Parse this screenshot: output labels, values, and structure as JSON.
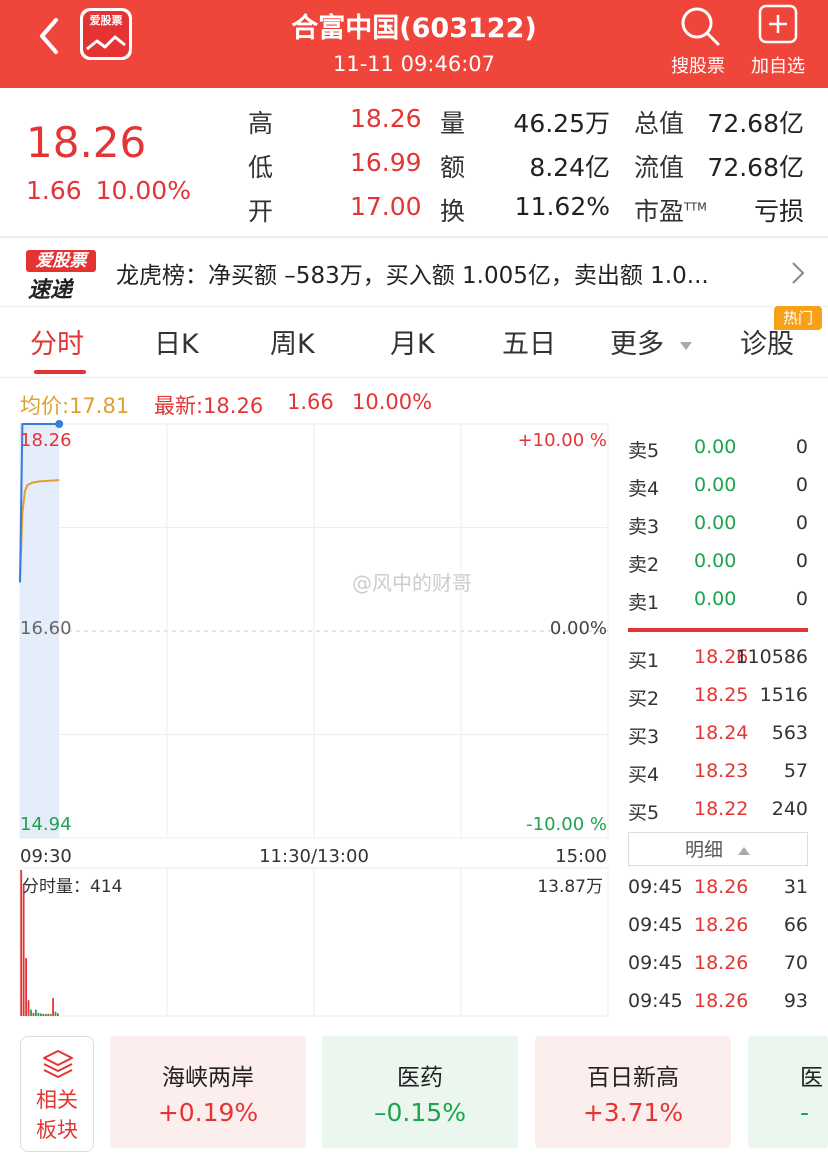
{
  "header": {
    "title": "合富中国(603122)",
    "datetime": "11-11 09:46:07",
    "logo_text": "爱股票",
    "search_label": "搜股票",
    "add_label": "加自选"
  },
  "quote": {
    "price": "18.26",
    "change": "1.66",
    "change_pct": "10.00%",
    "high_label": "高",
    "high": "18.26",
    "low_label": "低",
    "low": "16.99",
    "open_label": "开",
    "open": "17.00",
    "volume_label": "量",
    "volume": "46.25万",
    "amount_label": "额",
    "amount": "8.24亿",
    "turnover_label": "换",
    "turnover": "11.62%",
    "total_cap_label": "总值",
    "total_cap": "72.68亿",
    "float_cap_label": "流值",
    "float_cap": "72.68亿",
    "pe_label": "市盈",
    "pe_sup": "TTM",
    "pe": "亏损"
  },
  "news": {
    "logo_top": "爱股票",
    "logo_bottom": "速递",
    "text": "龙虎榜：净买额 –583万，买入额 1.005亿，卖出额 1.0..."
  },
  "tabs": {
    "items": [
      "分时",
      "日K",
      "周K",
      "月K",
      "五日",
      "更多",
      "诊股"
    ],
    "active": "分时",
    "hot_badge": "热门"
  },
  "legend": {
    "avg_label": "均价:17.81",
    "latest_label": "最新:18.26",
    "change": "1.66",
    "change_pct": "10.00%"
  },
  "chart_data": {
    "type": "line",
    "price_top": "18.26",
    "price_mid": "16.60",
    "price_bottom": "14.94",
    "pct_top": "+10.00 %",
    "pct_mid": "0.00%",
    "pct_bottom": "-10.00 %",
    "x_ticks": [
      "09:30",
      "11:30/13:00",
      "15:00"
    ],
    "ylim": [
      14.94,
      18.26
    ],
    "minutes_total": 240,
    "price_series": {
      "minute": [
        0,
        1,
        2,
        3,
        4,
        5,
        16
      ],
      "values": [
        16.99,
        18.26,
        18.26,
        18.26,
        18.26,
        18.26,
        18.26
      ]
    },
    "avg_series": {
      "minute": [
        0,
        1,
        2,
        3,
        5,
        8,
        16
      ],
      "values": [
        17.0,
        17.55,
        17.72,
        17.77,
        17.79,
        17.8,
        17.81
      ]
    },
    "volume_label": "分时量：414",
    "volume_max_label": "13.87万",
    "volume_max": 138700,
    "volume_bars": [
      {
        "minute": 0,
        "value": 138700,
        "dir": "up"
      },
      {
        "minute": 1,
        "value": 125000,
        "dir": "up"
      },
      {
        "minute": 2,
        "value": 55000,
        "dir": "up"
      },
      {
        "minute": 3,
        "value": 15000,
        "dir": "up"
      },
      {
        "minute": 4,
        "value": 6000,
        "dir": "down"
      },
      {
        "minute": 5,
        "value": 3000,
        "dir": "up"
      },
      {
        "minute": 6,
        "value": 6000,
        "dir": "down"
      },
      {
        "minute": 7,
        "value": 3000,
        "dir": "down"
      },
      {
        "minute": 8,
        "value": 2500,
        "dir": "down"
      },
      {
        "minute": 9,
        "value": 2000,
        "dir": "up"
      },
      {
        "minute": 10,
        "value": 2000,
        "dir": "down"
      },
      {
        "minute": 11,
        "value": 2000,
        "dir": "up"
      },
      {
        "minute": 12,
        "value": 2000,
        "dir": "down"
      },
      {
        "minute": 13,
        "value": 17000,
        "dir": "up"
      },
      {
        "minute": 14,
        "value": 4000,
        "dir": "down"
      },
      {
        "minute": 15,
        "value": 2500,
        "dir": "up"
      }
    ]
  },
  "watermark": "@风中的财哥",
  "order_book": {
    "sells": [
      {
        "name": "卖5",
        "price": "0.00",
        "vol": "0"
      },
      {
        "name": "卖4",
        "price": "0.00",
        "vol": "0"
      },
      {
        "name": "卖3",
        "price": "0.00",
        "vol": "0"
      },
      {
        "name": "卖2",
        "price": "0.00",
        "vol": "0"
      },
      {
        "name": "卖1",
        "price": "0.00",
        "vol": "0"
      }
    ],
    "buys": [
      {
        "name": "买1",
        "price": "18.26",
        "vol": "110586"
      },
      {
        "name": "买2",
        "price": "18.25",
        "vol": "1516"
      },
      {
        "name": "买3",
        "price": "18.24",
        "vol": "563"
      },
      {
        "name": "买4",
        "price": "18.23",
        "vol": "57"
      },
      {
        "name": "买5",
        "price": "18.22",
        "vol": "240"
      }
    ],
    "detail_label": "明细",
    "ticks": [
      {
        "time": "09:45",
        "price": "18.26",
        "vol": "31"
      },
      {
        "time": "09:45",
        "price": "18.26",
        "vol": "66"
      },
      {
        "time": "09:45",
        "price": "18.26",
        "vol": "70"
      },
      {
        "time": "09:45",
        "price": "18.26",
        "vol": "93"
      }
    ]
  },
  "sectors": {
    "related_label_1": "相关",
    "related_label_2": "板块",
    "cards": [
      {
        "name": "海峡两岸",
        "pct": "+0.19%",
        "dir": "up"
      },
      {
        "name": "医药",
        "pct": "–0.15%",
        "dir": "down"
      },
      {
        "name": "百日新高",
        "pct": "+3.71%",
        "dir": "up"
      },
      {
        "name": "医",
        "pct": "-",
        "dir": "down"
      }
    ]
  },
  "colors": {
    "brand_red": "#f0453b",
    "up_red": "#e33535",
    "down_green": "#1ea44e",
    "avg_line": "#e0a030",
    "price_line": "#3a7be0",
    "hot_orange": "#f7a11a"
  }
}
